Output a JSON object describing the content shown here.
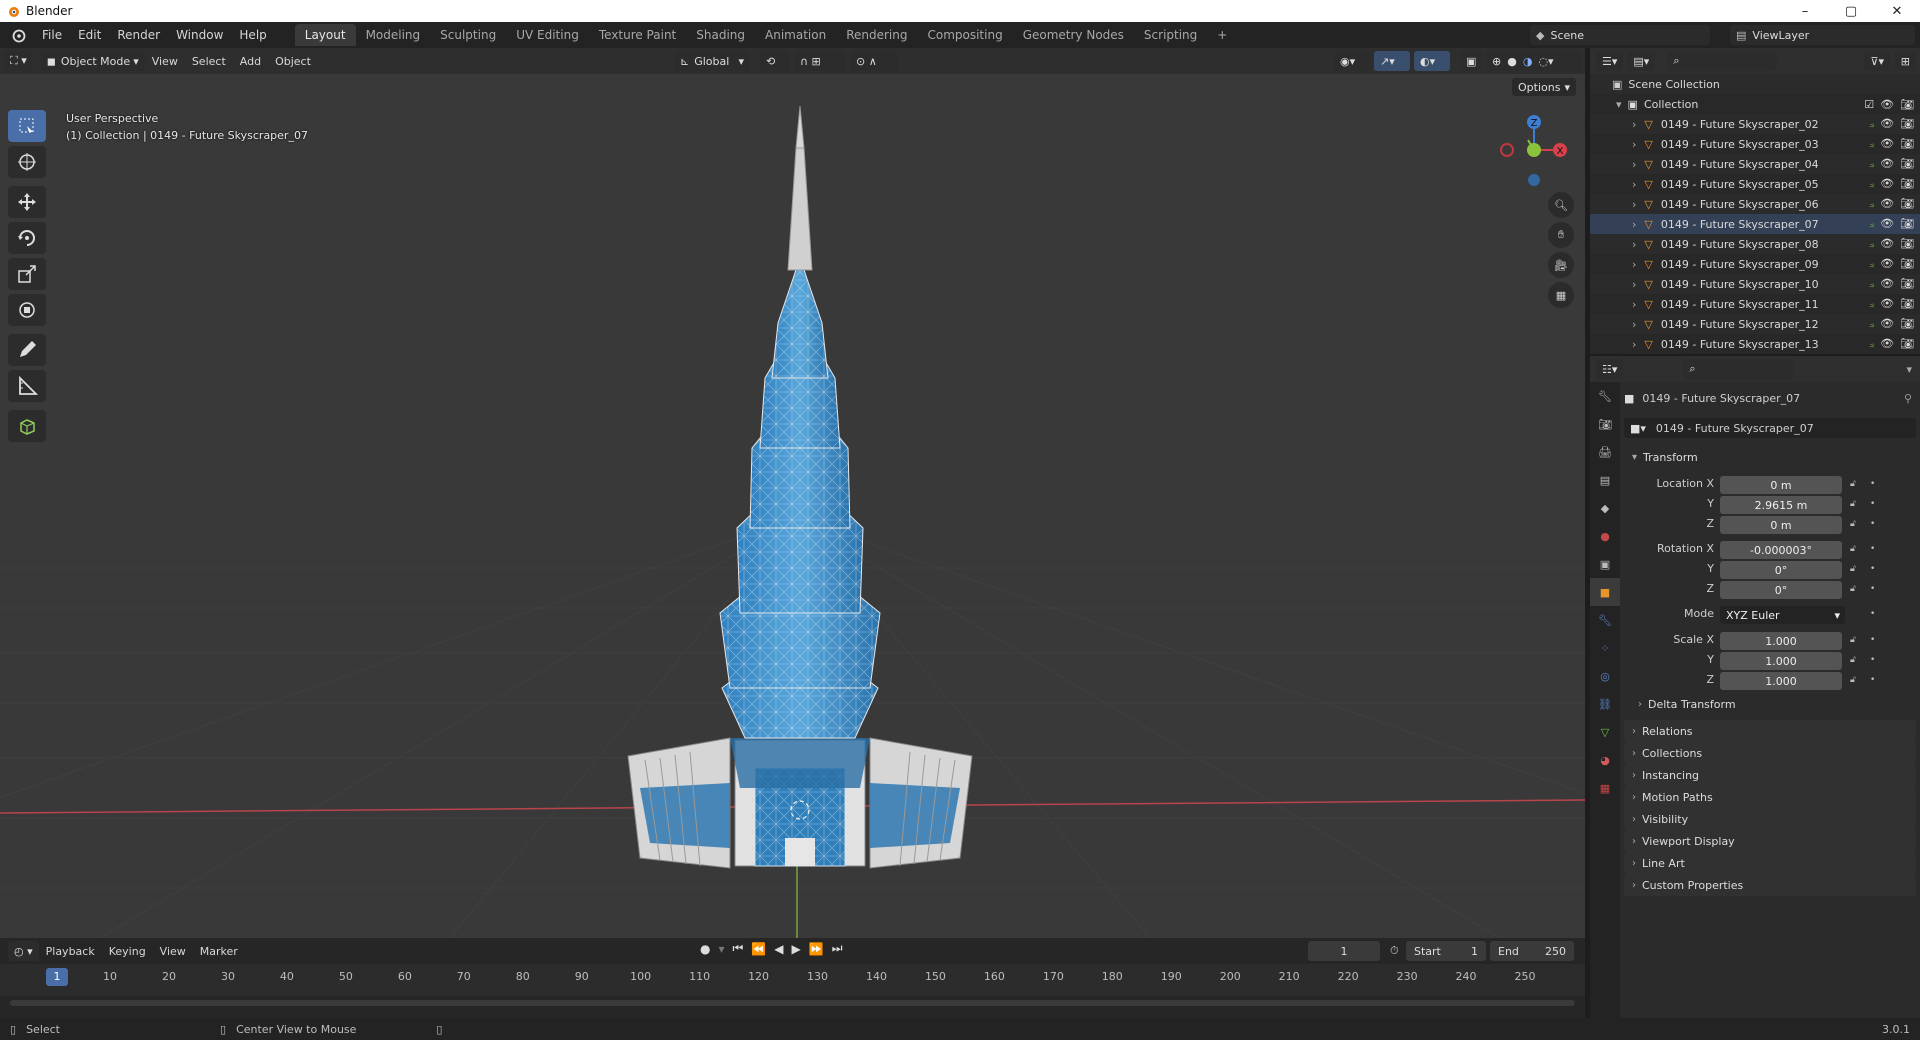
{
  "os": {
    "app_title": "Blender",
    "min": "–",
    "max": "▢",
    "close": "✕"
  },
  "menus": [
    "File",
    "Edit",
    "Render",
    "Window",
    "Help"
  ],
  "workspaces": [
    "Layout",
    "Modeling",
    "Sculpting",
    "UV Editing",
    "Texture Paint",
    "Shading",
    "Animation",
    "Rendering",
    "Compositing",
    "Geometry Nodes",
    "Scripting",
    "+"
  ],
  "active_workspace": "Layout",
  "scene": "Scene",
  "view_layer": "ViewLayer",
  "viewport": {
    "mode": "Object Mode",
    "menus": [
      "View",
      "Select",
      "Add",
      "Object"
    ],
    "orientation": "Global",
    "options": "Options",
    "perspective": "User Perspective",
    "collection_info": "(1) Collection | 0149 - Future Skyscraper_07"
  },
  "gizmo": {
    "z": "Z",
    "x": "X"
  },
  "timeline": {
    "menus": [
      "Playback",
      "Keying",
      "View",
      "Marker"
    ],
    "current_frame": "1",
    "start_label": "Start",
    "start": "1",
    "end_label": "End",
    "end": "250",
    "ticks": [
      "1",
      "10",
      "20",
      "30",
      "40",
      "50",
      "60",
      "70",
      "80",
      "90",
      "100",
      "110",
      "120",
      "130",
      "140",
      "150",
      "160",
      "170",
      "180",
      "190",
      "200",
      "210",
      "220",
      "230",
      "240",
      "250"
    ]
  },
  "status": {
    "select": "Select",
    "center": "Center View to Mouse",
    "version": "3.0.1"
  },
  "outliner": {
    "scene_collection": "Scene Collection",
    "collection": "Collection",
    "items": [
      "0149 - Future Skyscraper_02",
      "0149 - Future Skyscraper_03",
      "0149 - Future Skyscraper_04",
      "0149 - Future Skyscraper_05",
      "0149 - Future Skyscraper_06",
      "0149 - Future Skyscraper_07",
      "0149 - Future Skyscraper_08",
      "0149 - Future Skyscraper_09",
      "0149 - Future Skyscraper_10",
      "0149 - Future Skyscraper_11",
      "0149 - Future Skyscraper_12",
      "0149 - Future Skyscraper_13"
    ]
  },
  "properties": {
    "object_name": "0149 - Future Skyscraper_07",
    "datablock": "0149 - Future Skyscraper_07",
    "transform": "Transform",
    "location_label": "Location X",
    "loc_x": "0 m",
    "loc_y": "2.9615 m",
    "loc_z": "0 m",
    "rotation_label": "Rotation X",
    "rot_x": "-0.000003°",
    "rot_y": "0°",
    "rot_z": "0°",
    "mode_label": "Mode",
    "mode": "XYZ Euler",
    "scale_label": "Scale X",
    "scale_x": "1.000",
    "scale_y": "1.000",
    "scale_z": "1.000",
    "y": "Y",
    "z": "Z",
    "delta": "Delta Transform",
    "panels": [
      "Relations",
      "Collections",
      "Instancing",
      "Motion Paths",
      "Visibility",
      "Viewport Display",
      "Line Art",
      "Custom Properties"
    ]
  },
  "colors": {
    "accent": "#4a6fa8",
    "x_axis": "#d8414a",
    "y_axis": "#8ac33a",
    "z_axis": "#3d7ed3",
    "object_orange": "#e6952d"
  }
}
